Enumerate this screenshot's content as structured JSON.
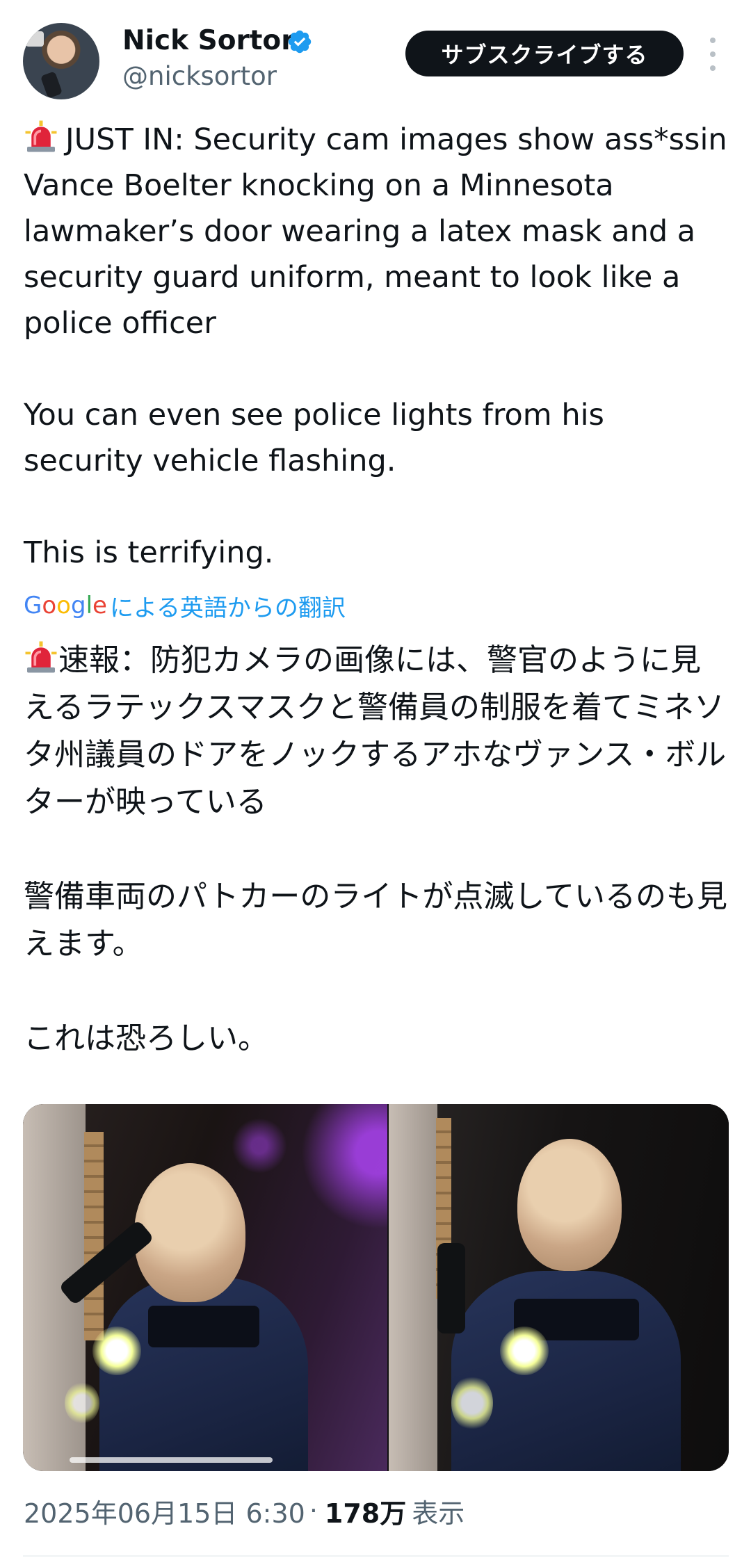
{
  "author": {
    "display_name": "Nick Sortor",
    "handle": "@nicksortor",
    "verified": true
  },
  "subscribe_button": {
    "label": "サブスクライブする"
  },
  "tweet": {
    "text": "JUST IN: Security cam images show ass*ssin Vance Boelter knocking on a Minnesota lawmaker’s door wearing a latex mask and a security guard uniform, meant to look like a police officer\n\nYou can even see police lights from his security vehicle flashing.\n\nThis is terrifying.",
    "translation_source": "Google",
    "translation_label": "による英語からの翻訳",
    "translated_text": "速報：防犯カメラの画像には、警官のように見えるラテックスマスクと警備員の制服を着てミネソタ州議員のドアをノックするアホなヴァンス・ボルターが映っている\n\n警備車両のパトカーのライトが点滅しているのも見えます。\n\nこれは恐ろしい。",
    "emoji": "siren-icon"
  },
  "meta": {
    "timestamp": "2025年06月15日 6:30",
    "separator": "·",
    "views_count": "178万",
    "views_label": "表示"
  },
  "colors": {
    "text_primary": "#0f1419",
    "text_secondary": "#536471",
    "link_blue": "#1d9bf0",
    "verified_blue": "#1d9bf0",
    "subscribe_bg": "#0f1419"
  }
}
